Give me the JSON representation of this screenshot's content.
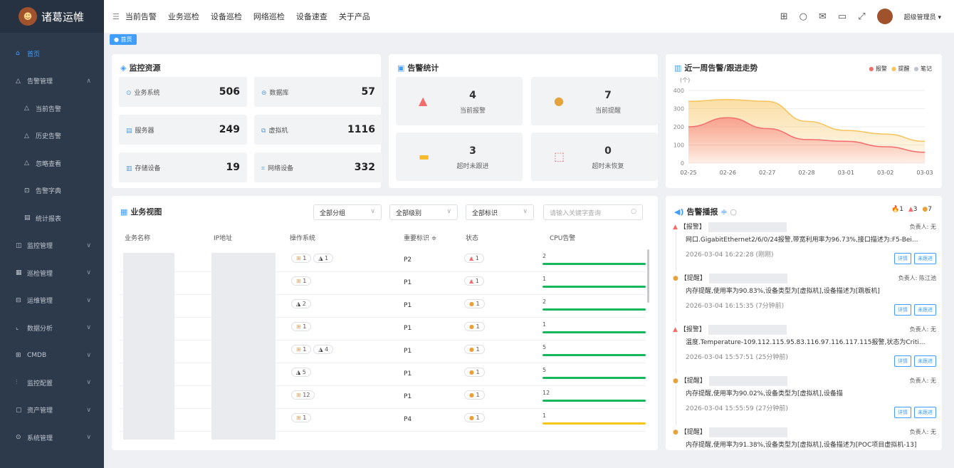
{
  "app": {
    "logo_text": "诸葛运帷"
  },
  "nav": {
    "items": [
      "当前告警",
      "业务巡检",
      "设备巡检",
      "网络巡检",
      "设备速查",
      "关于产品"
    ]
  },
  "user": {
    "name": "超级管理员"
  },
  "tabs": {
    "home": "首页"
  },
  "sidebar": {
    "items": [
      {
        "label": "首页",
        "icon": "home-icon",
        "active": true
      },
      {
        "label": "告警管理",
        "icon": "bell-icon",
        "expanded": true
      },
      {
        "label": "当前告警",
        "icon": "bell-icon",
        "sub": true
      },
      {
        "label": "历史告警",
        "icon": "bell-icon",
        "sub": true
      },
      {
        "label": "忽略查看",
        "icon": "bell-icon",
        "sub": true
      },
      {
        "label": "告警字典",
        "icon": "dict-icon",
        "sub": true
      },
      {
        "label": "统计报表",
        "icon": "report-icon",
        "sub": true
      },
      {
        "label": "监控管理",
        "icon": "monitor-icon"
      },
      {
        "label": "巡检管理",
        "icon": "inspect-icon"
      },
      {
        "label": "运维管理",
        "icon": "ops-icon"
      },
      {
        "label": "数据分析",
        "icon": "chart-icon"
      },
      {
        "label": "CMDB",
        "icon": "cmdb-icon"
      },
      {
        "label": "监控配置",
        "icon": "config-icon"
      },
      {
        "label": "资产管理",
        "icon": "asset-icon"
      },
      {
        "label": "系统管理",
        "icon": "system-icon"
      }
    ]
  },
  "monitor": {
    "title": "监控资源",
    "items": [
      {
        "label": "业务系统",
        "value": "506"
      },
      {
        "label": "数据库",
        "value": "57"
      },
      {
        "label": "服务器",
        "value": "249"
      },
      {
        "label": "虚拟机",
        "value": "1116"
      },
      {
        "label": "存储设备",
        "value": "19"
      },
      {
        "label": "网络设备",
        "value": "332"
      }
    ]
  },
  "alarm_stats": {
    "title": "告警统计",
    "items": [
      {
        "value": "4",
        "label": "当前报警",
        "color": "#f56c6c"
      },
      {
        "value": "7",
        "label": "当前提醒",
        "color": "#e6a23c"
      },
      {
        "value": "3",
        "label": "超时未跟进",
        "color": "#f7ba2a"
      },
      {
        "value": "0",
        "label": "超时未恢复",
        "color": "#f56c6c"
      }
    ]
  },
  "trend": {
    "title": "近一周告警/跟进走势",
    "unit": "(个)",
    "legend": [
      "报警",
      "提醒",
      "笔记"
    ]
  },
  "chart_data": {
    "type": "area",
    "x": [
      "02-25",
      "02-26",
      "02-27",
      "02-28",
      "03-01",
      "03-02",
      "03-03"
    ],
    "ylim": [
      0,
      400
    ],
    "yticks": [
      0,
      100,
      200,
      300,
      400
    ],
    "series": [
      {
        "name": "报警",
        "color": "#f56c6c",
        "values": [
          200,
          250,
          190,
          130,
          120,
          90,
          60
        ]
      },
      {
        "name": "提醒",
        "color": "#f7c35c",
        "values": [
          340,
          350,
          340,
          230,
          180,
          160,
          120
        ]
      },
      {
        "name": "笔记",
        "color": "#c0c4cc",
        "values": [
          0,
          0,
          0,
          0,
          0,
          0,
          0
        ]
      }
    ]
  },
  "biz": {
    "title": "业务视图",
    "filters": [
      "全部分组",
      "全部级别",
      "全部标识"
    ],
    "search_placeholder": "请输入关键字查询",
    "headers": [
      "业务名称",
      "IP地址",
      "操作系统",
      "重要标识 ≑",
      "状态",
      "CPU告警"
    ],
    "rows": [
      {
        "os1": "1",
        "os2": "1",
        "level": "P2",
        "status": "1",
        "cpu": "2",
        "cpu_pct": 1,
        "bar": "#19b45c",
        "stat_ic": "🔥"
      },
      {
        "os1": "1",
        "os2": "",
        "level": "P1",
        "status": "1",
        "cpu": "1",
        "cpu_pct": 1,
        "bar": "#19b45c",
        "stat_ic": "🔔"
      },
      {
        "os1": "",
        "os2": "2",
        "level": "P1",
        "status": "1",
        "cpu": "2",
        "cpu_pct": 1,
        "bar": "#19b45c",
        "stat_ic": "💡"
      },
      {
        "os1": "1",
        "os2": "",
        "level": "P1",
        "status": "1",
        "cpu": "1",
        "cpu_pct": 1,
        "bar": "#19b45c",
        "stat_ic": "💡"
      },
      {
        "os1": "1",
        "os2": "4",
        "level": "P1",
        "status": "1",
        "cpu": "5",
        "cpu_pct": 1,
        "bar": "#19b45c",
        "stat_ic": "💡"
      },
      {
        "os1": "",
        "os2": "5",
        "level": "P1",
        "status": "1",
        "cpu": "5",
        "cpu_pct": 1,
        "bar": "#19b45c",
        "stat_ic": "💡"
      },
      {
        "os1": "12",
        "os2": "",
        "level": "P1",
        "status": "1",
        "cpu": "12",
        "cpu_pct": 1,
        "bar": "#19b45c",
        "stat_ic": "💡"
      },
      {
        "os1": "1",
        "os2": "",
        "level": "P4",
        "status": "1",
        "cpu": "1",
        "cpu_pct": 1,
        "bar": "#f5c518",
        "stat_ic": "💡"
      }
    ]
  },
  "broadcast": {
    "title": "告警播报",
    "counts": [
      "1",
      "3",
      "7"
    ],
    "items": [
      {
        "type": "【报警】",
        "owner": "负责人: 无",
        "text": "网口.GigabitEthernet2/6/0/24报警,带宽利用率为96.73%,接口描述为:F5-Bei...",
        "time": "2026-03-04 16:22:28 (刚刚)",
        "color": "#f56c6c"
      },
      {
        "type": "【提醒】",
        "owner": "负责人: 陈江池",
        "text": "内存提醒,使用率为90.83%,设备类型为[虚拟机],设备描述为[跳板机]",
        "time": "2026-03-04 16:15:35 (7分钟前)",
        "color": "#e6a23c"
      },
      {
        "type": "【报警】",
        "owner": "负责人: 无",
        "text": "温度.Temperature-109.112.115.95.83.116.97.116.117.115报警,状态为Criti...",
        "time": "2026-03-04 15:57:51 (25分钟前)",
        "color": "#f56c6c"
      },
      {
        "type": "【提醒】",
        "owner": "负责人: 无",
        "text": "内存提醒,使用率为90.02%,设备类型为[虚拟机],设备描",
        "time": "2026-03-04 15:55:59 (27分钟前)",
        "color": "#e6a23c"
      },
      {
        "type": "【提醒】",
        "owner": "负责人: 无",
        "text": "内存提醒,使用率为91.38%,设备类型为[虚拟机],设备描述为[POC项目虚拟机-13]",
        "time": "",
        "color": "#e6a23c"
      }
    ],
    "btn_detail": "详情",
    "btn_follow": "未跟进"
  }
}
